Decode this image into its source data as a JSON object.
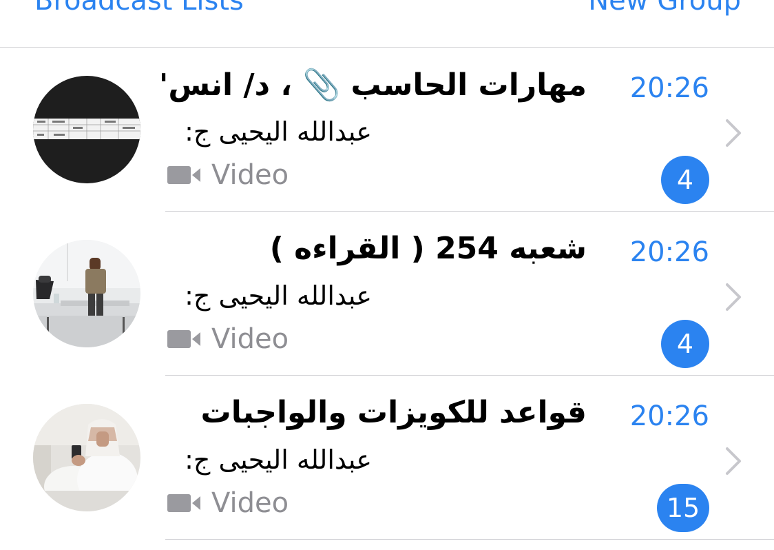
{
  "header": {
    "left_link": "Broadcast Lists",
    "right_link": "New Group"
  },
  "chats": [
    {
      "title": "مهارات الحاسب 📎 ، د/ انس'",
      "sender": "عبدالله اليحيى ج:",
      "preview": "Video",
      "time": "20:26",
      "unread": "4"
    },
    {
      "title": "شعبه 254 ( القراءه )",
      "sender": "عبدالله اليحيى ج:",
      "preview": "Video",
      "time": "20:26",
      "unread": "4"
    },
    {
      "title": "قواعد للكويزات والواجبات",
      "sender": "عبدالله اليحيى ج:",
      "preview": "Video",
      "time": "20:26",
      "unread": "15"
    }
  ],
  "colors": {
    "accent": "#2b83f0",
    "secondary_text": "#8e8e93",
    "separator": "#cfcfd3"
  },
  "icons": {
    "preview": "video-camera-icon",
    "disclosure": "chevron-right-icon"
  }
}
